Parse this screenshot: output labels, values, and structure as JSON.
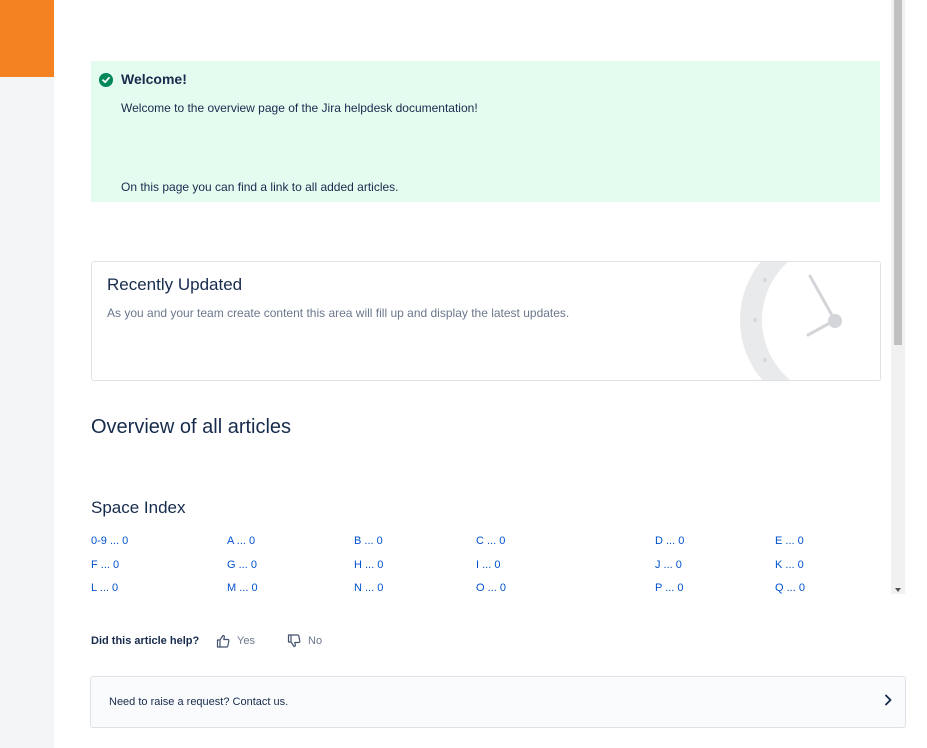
{
  "panel": {
    "title": "Welcome!",
    "line1": "Welcome to the overview page of the Jira helpdesk documentation!",
    "line2": "On this page you can find a link to all added articles."
  },
  "recently_updated": {
    "title": "Recently Updated",
    "description": "As you and your team create content this area will fill up and display the latest updates."
  },
  "overview_title": "Overview of all articles",
  "space_index": {
    "title": "Space Index",
    "entries": [
      "0-9 ... 0",
      "A ... 0",
      "B ... 0",
      "C ... 0",
      "D ... 0",
      "E ... 0",
      "F ... 0",
      "G ... 0",
      "H ... 0",
      "I ... 0",
      "J ... 0",
      "K ... 0",
      "L ... 0",
      "M ... 0",
      "N ... 0",
      "O ... 0",
      "P ... 0",
      "Q ... 0"
    ]
  },
  "feedback": {
    "question": "Did this article help?",
    "yes": "Yes",
    "no": "No"
  },
  "request": {
    "text": "Need to raise a request? Contact us."
  },
  "icons": {
    "panel_icon": "check-circle-icon",
    "yes_icon": "thumbs-up-icon",
    "no_icon": "thumbs-down-icon",
    "request_icon": "chevron-right-icon"
  },
  "colors": {
    "brand_orange": "#f58220",
    "success_bg": "#e3fcef",
    "success_icon": "#00875a",
    "link": "#0052cc",
    "text": "#172b4d"
  }
}
